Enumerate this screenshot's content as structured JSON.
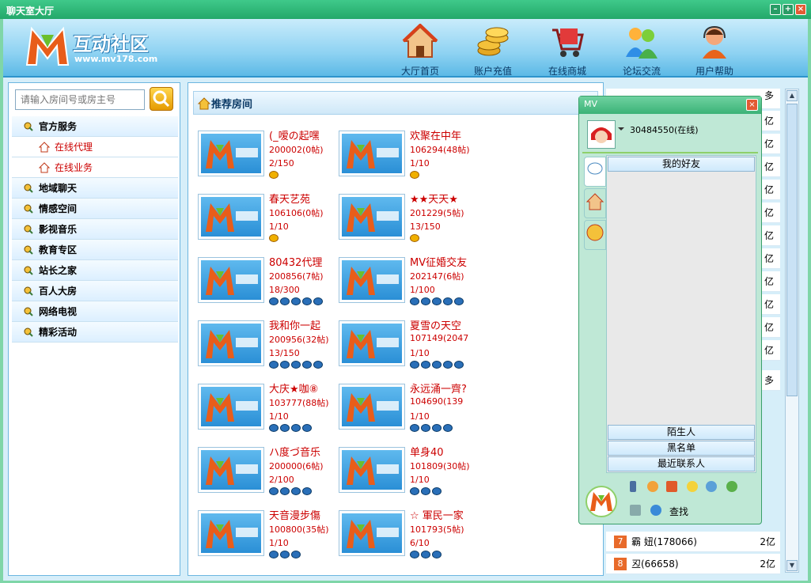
{
  "window": {
    "title": "聊天室大厅"
  },
  "header": {
    "logo_text": "互动社区",
    "logo_url": "www.mv178.com",
    "nav": [
      {
        "label": "大厅首页",
        "icon": "house-icon"
      },
      {
        "label": "账户充值",
        "icon": "coins-icon"
      },
      {
        "label": "在线商城",
        "icon": "shopping-cart-icon"
      },
      {
        "label": "论坛交流",
        "icon": "people-icon"
      },
      {
        "label": "用户帮助",
        "icon": "support-agent-icon"
      }
    ]
  },
  "search": {
    "placeholder": "请输入房间号或房主号"
  },
  "sidebar": {
    "items": [
      {
        "label": "官方服务",
        "sub": false
      },
      {
        "label": "在线代理",
        "sub": true
      },
      {
        "label": "在线业务",
        "sub": true
      },
      {
        "label": "地域聊天",
        "sub": false
      },
      {
        "label": "情感空间",
        "sub": false
      },
      {
        "label": "影视音乐",
        "sub": false
      },
      {
        "label": "教育专区",
        "sub": false
      },
      {
        "label": "站长之家",
        "sub": false
      },
      {
        "label": "百人大房",
        "sub": false
      },
      {
        "label": "网络电视",
        "sub": false
      },
      {
        "label": "精彩活动",
        "sub": false
      }
    ]
  },
  "main": {
    "title": "推荐房间",
    "rooms": [
      {
        "name": "(_嗳の起嘿",
        "id": "200002(0帖)",
        "count": "2/150",
        "badges": 1,
        "gold": true
      },
      {
        "name": "欢聚在中年",
        "id": "106294(48帖)",
        "count": "1/10",
        "badges": 1,
        "gold": true
      },
      {
        "name": "春天艺苑",
        "id": "106106(0帖)",
        "count": "1/10",
        "badges": 1,
        "gold": true
      },
      {
        "name": "★★天天★",
        "id": "201229(5帖)",
        "count": "13/150",
        "badges": 1,
        "gold": true
      },
      {
        "name": "80432代理",
        "id": "200856(7帖)",
        "count": "18/300",
        "badges": 5,
        "gold": false
      },
      {
        "name": "MV征婚交友",
        "id": "202147(6帖)",
        "count": "1/100",
        "badges": 5,
        "gold": false
      },
      {
        "name": "我和你一起",
        "id": "200956(32帖)",
        "count": "13/150",
        "badges": 5,
        "gold": false
      },
      {
        "name": "夏雪の天空",
        "id": "107149(2047",
        "count": "1/10",
        "badges": 5,
        "gold": false
      },
      {
        "name": "大庆★咖⑧",
        "id": "103777(88帖)",
        "count": "1/10",
        "badges": 4,
        "gold": false
      },
      {
        "name": "永远涌一齊?",
        "id": "104690(139",
        "count": "1/10",
        "badges": 4,
        "gold": false
      },
      {
        "name": "ハ度づ音乐",
        "id": "200000(6帖)",
        "count": "2/100",
        "badges": 4,
        "gold": false
      },
      {
        "name": "单身40",
        "id": "101809(30帖)",
        "count": "1/10",
        "badges": 3,
        "gold": false
      },
      {
        "name": "天音漫步傷",
        "id": "100800(35帖)",
        "count": "1/10",
        "badges": 3,
        "gold": false
      },
      {
        "name": "☆ 軍民一家",
        "id": "101793(5帖)",
        "count": "6/10",
        "badges": 3,
        "gold": false
      }
    ]
  },
  "ranking": {
    "header_more": "多",
    "values": [
      "亿",
      "亿",
      "亿",
      "亿",
      "亿",
      "亿",
      "亿",
      "亿",
      "亿",
      "亿",
      "亿"
    ],
    "rows": [
      {
        "rank": "7",
        "name": "霸 妞(178066)",
        "value": "2亿"
      },
      {
        "rank": "8",
        "name": "丒(66658)",
        "value": "2亿"
      }
    ]
  },
  "friends_popup": {
    "title": "MV",
    "user": "30484550(在线)",
    "group_top": "我的好友",
    "groups": [
      "陌生人",
      "黑名单",
      "最近联系人"
    ],
    "find_label": "查找"
  }
}
